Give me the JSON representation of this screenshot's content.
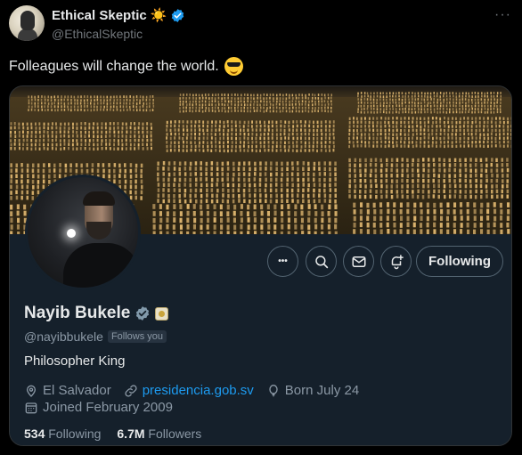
{
  "tweet": {
    "author_name": "Ethical Skeptic",
    "author_emoji": "☀️",
    "author_handle": "@EthicalSkeptic",
    "text": "Folleagues will change the world."
  },
  "card": {
    "buttons": {
      "more_label": "•••",
      "following_label": "Following"
    },
    "profile": {
      "name": "Nayib Bukele",
      "handle": "@nayibbukele",
      "follows_you": "Follows you",
      "bio": "Philosopher King",
      "location": "El Salvador",
      "website": "presidencia.gob.sv",
      "birthday": "Born July 24",
      "joined": "Joined February 2009",
      "following_count": "534",
      "following_label": "Following",
      "followers_count": "6.7M",
      "followers_label": "Followers"
    }
  },
  "colors": {
    "background": "#000000",
    "card_bg": "#15202b",
    "verified": "#1d9bf0",
    "link": "#1d9bf0",
    "muted": "#8b98a5"
  }
}
